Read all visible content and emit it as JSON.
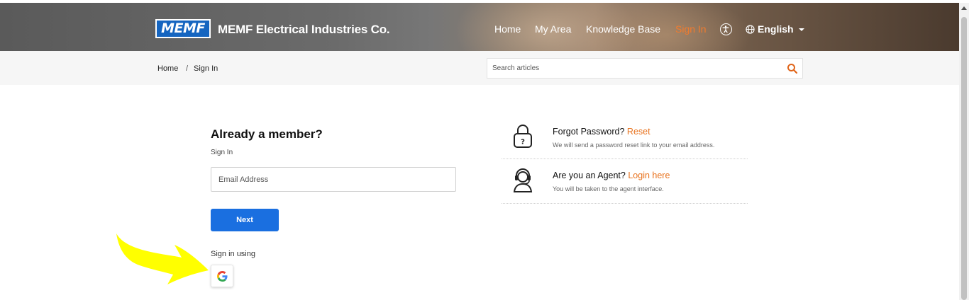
{
  "header": {
    "logo_text": "MEMF",
    "brand_name": "MEMF Electrical Industries Co.",
    "nav": [
      {
        "label": "Home"
      },
      {
        "label": "My Area"
      },
      {
        "label": "Knowledge Base"
      },
      {
        "label": "Sign In",
        "active": true
      }
    ],
    "accessibility_icon": "accessibility-icon",
    "language": "English",
    "accent_color": "#f07b2e"
  },
  "breadcrumb": {
    "home": "Home",
    "separator": "/",
    "current": "Sign In"
  },
  "search": {
    "placeholder": "Search articles",
    "icon": "search-icon"
  },
  "login": {
    "heading": "Already a member?",
    "subheading": "Sign In",
    "email_placeholder": "Email Address",
    "next_label": "Next",
    "next_color": "#1a6fe0",
    "sign_in_using": "Sign in using",
    "provider_icon": "google-icon"
  },
  "info": {
    "forgot": {
      "title": "Forgot Password?",
      "link": "Reset",
      "desc": "We will send a password reset link to your email address.",
      "icon": "padlock-question-icon"
    },
    "agent": {
      "title": "Are you an Agent?",
      "link": "Login here",
      "desc": "You will be taken to the agent interface.",
      "icon": "headset-agent-icon"
    }
  },
  "annotation": {
    "icon": "yellow-arrow-icon",
    "color": "#ffff00"
  }
}
